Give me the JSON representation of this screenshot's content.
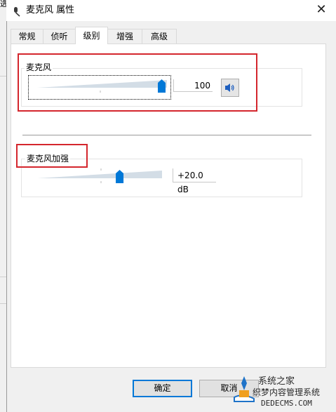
{
  "window": {
    "title": "麦克风 属性",
    "close_glyph": "✕",
    "behind_char": "选"
  },
  "tabs": [
    {
      "label": "常规",
      "active": false
    },
    {
      "label": "侦听",
      "active": false
    },
    {
      "label": "级别",
      "active": true
    },
    {
      "label": "增强",
      "active": false
    },
    {
      "label": "高级",
      "active": false
    }
  ],
  "microphone": {
    "label": "麦克风",
    "value": "100",
    "level": 1.0,
    "speaker_icon": "speaker-icon"
  },
  "boost": {
    "label": "麦克风加强",
    "value": "+20.0 dB",
    "level": 0.667
  },
  "buttons": {
    "ok": "确定",
    "cancel": "取消"
  },
  "watermark": {
    "line1": "系统之家",
    "line2": "织梦内容管理系统",
    "line3": "DEDECMS.COM"
  },
  "colors": {
    "highlight_box": "#d4262d",
    "thumb": "#0078d7",
    "default_button_border": "#0078d7"
  }
}
